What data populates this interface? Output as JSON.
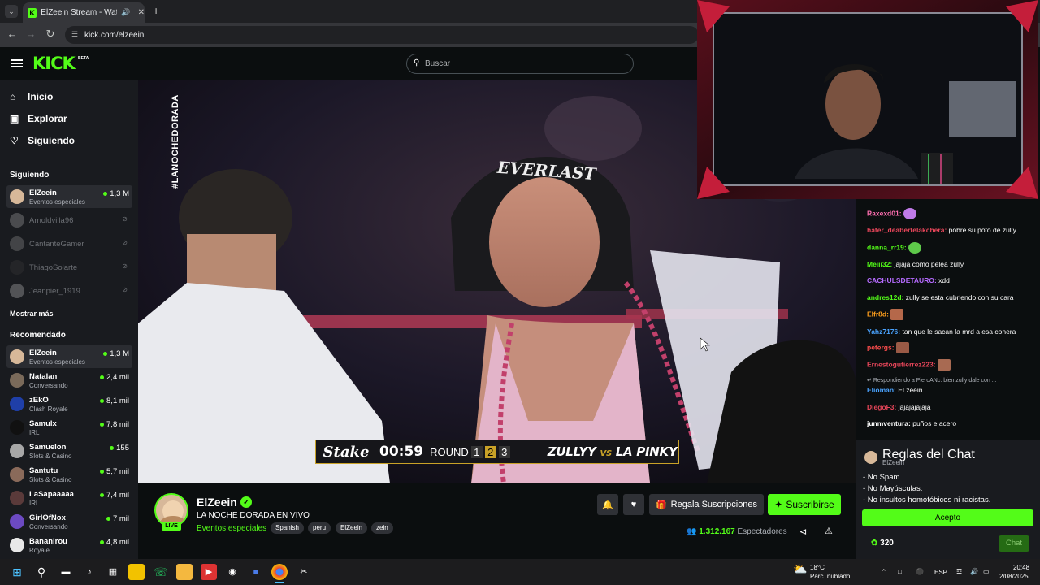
{
  "browser": {
    "tab_title": "ElZeein Stream - Watch Live",
    "url": "kick.com/elzeein",
    "tab_icon": "kick-logo-icon"
  },
  "header": {
    "logo": "KICK",
    "beta": "BETA",
    "search_placeholder": "Buscar"
  },
  "sidebar": {
    "nav": [
      {
        "label": "Inicio",
        "icon": "home-icon"
      },
      {
        "label": "Explorar",
        "icon": "compass-icon"
      },
      {
        "label": "Siguiendo",
        "icon": "heart-icon"
      }
    ],
    "following_title": "Siguiendo",
    "following": [
      {
        "name": "ElZeein",
        "category": "Eventos especiales",
        "viewers": "1,3 M",
        "live": true
      },
      {
        "name": "Arnoldvilla96",
        "live": false
      },
      {
        "name": "CantanteGamer",
        "live": false
      },
      {
        "name": "ThiagoSolarte",
        "live": false
      },
      {
        "name": "Jeanpier_1919",
        "live": false
      }
    ],
    "show_more": "Mostrar más",
    "recommended_title": "Recomendado",
    "recommended": [
      {
        "name": "ElZeein",
        "category": "Eventos especiales",
        "viewers": "1,3 M"
      },
      {
        "name": "Natalan",
        "category": "Conversando",
        "viewers": "2,4 mil"
      },
      {
        "name": "zEkO",
        "category": "Clash Royale",
        "viewers": "8,1 mil"
      },
      {
        "name": "Samulx",
        "category": "IRL",
        "viewers": "7,8 mil"
      },
      {
        "name": "Samuelon",
        "category": "Slots & Casino",
        "viewers": "155"
      },
      {
        "name": "Santutu",
        "category": "Slots & Casino",
        "viewers": "5,7 mil"
      },
      {
        "name": "LaSapaaaaa",
        "category": "IRL",
        "viewers": "7,4 mil"
      },
      {
        "name": "GirlOfNox",
        "category": "Conversando",
        "viewers": "7 mil"
      },
      {
        "name": "Bananirou",
        "category": "Royale",
        "viewers": "4,8 mil"
      }
    ]
  },
  "video": {
    "hashtag": "#LANOCHEDORADA",
    "sponsor": "Stake",
    "timer": "00:59",
    "round_label": "ROUND",
    "rounds": [
      "1",
      "2",
      "3"
    ],
    "current_round": "2",
    "fighter_a": "ZULLYY",
    "vs": "VS",
    "fighter_b": "LA PINKY",
    "headgear_brand": "EVERLAST"
  },
  "stream": {
    "channel": "ElZeein",
    "title": "LA NOCHE DORADA EN VIVO",
    "category": "Eventos especiales",
    "tags": [
      "Spanish",
      "peru",
      "ElZeein",
      "zein"
    ],
    "live_badge": "LIVE",
    "gift_label": "Regala Suscripciones",
    "subscribe_label": "Suscribirse",
    "viewers": "1.312.167",
    "viewers_label": "Espectadores"
  },
  "chat": {
    "messages": [
      {
        "user": "Raxexd01:",
        "text": "",
        "color": "#ff6fb0",
        "emote": "#c07ae8"
      },
      {
        "user": "hater_deabertelakchera:",
        "text": "pobre su poto de zully",
        "color": "#e8465a"
      },
      {
        "user": "danna_rr19:",
        "text": "",
        "color": "#53fc18",
        "emote": "#5ec94a"
      },
      {
        "user": "Meiii32:",
        "text": "jajaja como pelea zully",
        "color": "#53fc18"
      },
      {
        "user": "CACHULSDETAURO:",
        "text": "xdd",
        "color": "#b66bff"
      },
      {
        "user": "andres12d:",
        "text": "zully se esta cubriendo con su cara",
        "color": "#53fc18"
      },
      {
        "user": "Elfr8d:",
        "text": "",
        "color": "#ff9f1c",
        "emote": "#b5684a"
      },
      {
        "user": "Yahz7176:",
        "text": "tan que le sacan la mrd a esa conera",
        "color": "#4aa3ff"
      },
      {
        "user": "petergs:",
        "text": "",
        "color": "#ff4d4d",
        "emote": "#9a5a46"
      },
      {
        "user": "Ernestogutierrez223:",
        "text": "",
        "color": "#e8465a",
        "emote": "#a86a52"
      },
      {
        "user": "Elioman:",
        "text": "El zeein...",
        "color": "#4aa3ff",
        "reply": "Respondiendo a PieroANc: bien zully dale con ..."
      },
      {
        "user": "DiegoF3:",
        "text": "jajajajajaja",
        "color": "#e8465a"
      },
      {
        "user": "junmventura:",
        "text": "puños e acero",
        "color": "#fff"
      }
    ],
    "rules_title": "Reglas del Chat",
    "rules_channel": "ElZeein",
    "rules": [
      "- No Spam.",
      "- No Mayúsculas.",
      "- No insultos homofóbicos ni racistas."
    ],
    "accept_label": "Acepto",
    "points": "320",
    "chat_button": "Chat"
  },
  "taskbar": {
    "weather_temp": "18°C",
    "weather_desc": "Parc. nublado",
    "lang": "ESP",
    "time": "20:48",
    "date": "2/08/2025"
  },
  "colors": {
    "accent": "#53fc18",
    "background": "#0b0e0f",
    "sidebar": "#191b1f",
    "gold": "#c9a227"
  }
}
